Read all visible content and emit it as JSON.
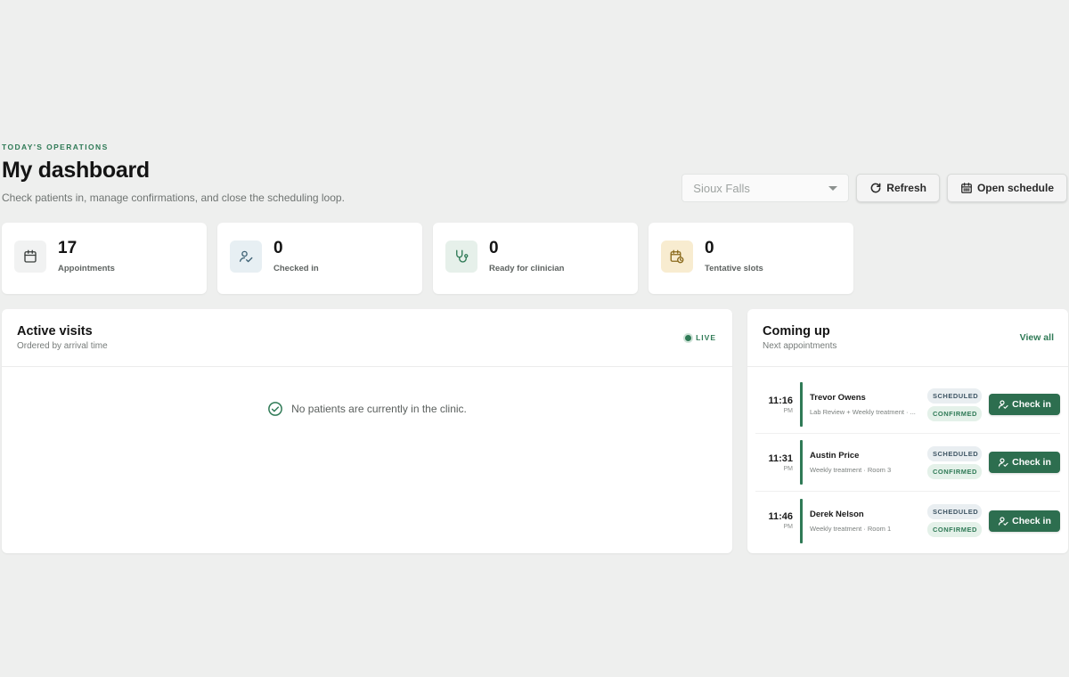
{
  "header": {
    "eyebrow": "TODAY'S OPERATIONS",
    "title": "My dashboard",
    "subtitle": "Check patients in, manage confirmations, and close the scheduling loop."
  },
  "toolbar": {
    "location_value": "Sioux Falls",
    "refresh_label": "Refresh",
    "open_schedule_label": "Open schedule"
  },
  "stats": [
    {
      "value": "17",
      "label": "Appointments",
      "icon": "calendar-icon"
    },
    {
      "value": "0",
      "label": "Checked in",
      "icon": "user-check-icon"
    },
    {
      "value": "0",
      "label": "Ready for clinician",
      "icon": "stethoscope-icon"
    },
    {
      "value": "0",
      "label": "Tentative slots",
      "icon": "calendar-clock-icon"
    }
  ],
  "active_visits": {
    "title": "Active visits",
    "subtitle": "Ordered by arrival time",
    "live_label": "LIVE",
    "empty_message": "No patients are currently in the clinic."
  },
  "coming_up": {
    "title": "Coming up",
    "subtitle": "Next appointments",
    "view_all_label": "View all",
    "appointments": [
      {
        "time": "11:16",
        "ampm": "PM",
        "name": "Trevor Owens",
        "desc": "Lab Review + Weekly treatment · ...",
        "status1": "SCHEDULED",
        "status2": "CONFIRMED",
        "action": "Check in"
      },
      {
        "time": "11:31",
        "ampm": "PM",
        "name": "Austin Price",
        "desc": "Weekly treatment · Room 3",
        "status1": "SCHEDULED",
        "status2": "CONFIRMED",
        "action": "Check in"
      },
      {
        "time": "11:46",
        "ampm": "PM",
        "name": "Derek Nelson",
        "desc": "Weekly treatment · Room 1",
        "status1": "SCHEDULED",
        "status2": "CONFIRMED",
        "action": "Check in"
      }
    ]
  },
  "colors": {
    "accent": "#2f7a56",
    "button_primary": "#2d6e4f",
    "background": "#eeefee"
  }
}
